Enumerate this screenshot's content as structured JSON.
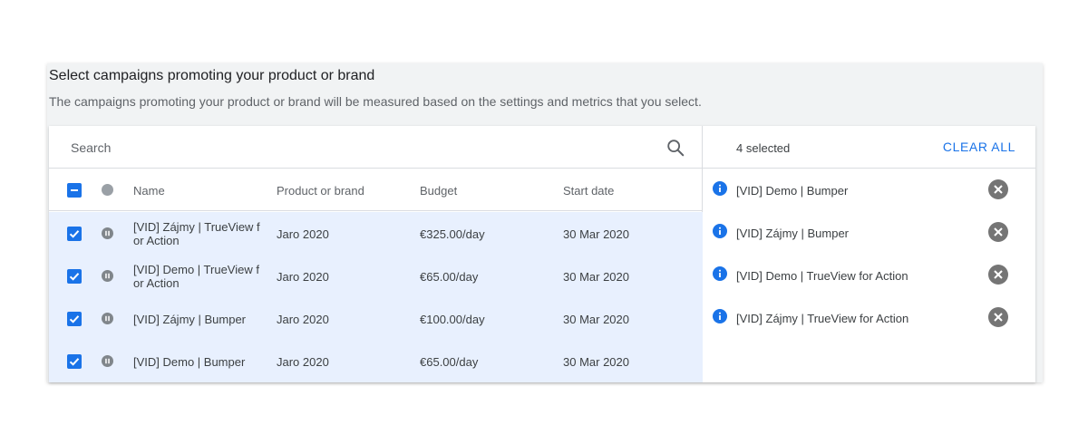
{
  "section": {
    "title": "Select campaigns promoting your product or brand",
    "description": "The campaigns promoting your product or brand will be measured based on the settings and metrics that you select."
  },
  "search": {
    "placeholder": "Search",
    "icon": "search-icon"
  },
  "table": {
    "columns": {
      "name": "Name",
      "product": "Product or brand",
      "budget": "Budget",
      "start_date": "Start date"
    },
    "rows": [
      {
        "name": "[VID] Zájmy | TrueView for Action",
        "product": "Jaro 2020",
        "budget": "€325.00/day",
        "start_date": "30 Mar 2020",
        "checked": true,
        "status": "paused"
      },
      {
        "name": "[VID] Demo | TrueView for Action",
        "product": "Jaro 2020",
        "budget": "€65.00/day",
        "start_date": "30 Mar 2020",
        "checked": true,
        "status": "paused"
      },
      {
        "name": "[VID] Zájmy | Bumper",
        "product": "Jaro 2020",
        "budget": "€100.00/day",
        "start_date": "30 Mar 2020",
        "checked": true,
        "status": "paused"
      },
      {
        "name": "[VID] Demo | Bumper",
        "product": "Jaro 2020",
        "budget": "€65.00/day",
        "start_date": "30 Mar 2020",
        "checked": true,
        "status": "paused"
      }
    ]
  },
  "selection": {
    "count_label": "4 selected",
    "clear_label": "CLEAR ALL",
    "items": [
      "[VID] Demo | Bumper",
      "[VID] Zájmy | Bumper",
      "[VID] Demo | TrueView for Action",
      "[VID] Zájmy | TrueView for Action"
    ]
  },
  "colors": {
    "accent": "#1a73e8",
    "row_selected": "#e8f0fe",
    "status_gray": "#80868b"
  }
}
